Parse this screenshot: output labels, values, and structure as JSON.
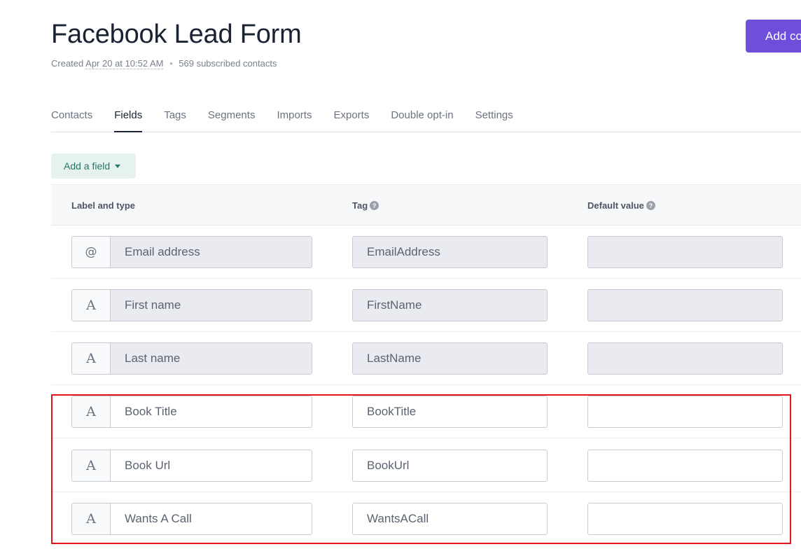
{
  "header": {
    "title": "Facebook Lead Form",
    "created_prefix": "Created",
    "created_date": "Apr 20 at 10:52 AM",
    "separator": "•",
    "subscribed": "569 subscribed contacts",
    "add_button_label": "Add contact"
  },
  "tabs": [
    {
      "label": "Contacts"
    },
    {
      "label": "Fields",
      "active": true
    },
    {
      "label": "Tags"
    },
    {
      "label": "Segments"
    },
    {
      "label": "Imports"
    },
    {
      "label": "Exports"
    },
    {
      "label": "Double opt-in"
    },
    {
      "label": "Settings"
    }
  ],
  "add_field": {
    "label": "Add a field"
  },
  "table": {
    "headers": {
      "label_type": "Label and type",
      "tag": "Tag",
      "default_value": "Default value",
      "help_glyph": "?"
    },
    "rows": [
      {
        "icon": "@",
        "icon_name": "email-type-icon",
        "label": "Email address",
        "tag": "EmailAddress",
        "default": "",
        "locked": true
      },
      {
        "icon": "A",
        "icon_name": "text-type-icon",
        "label": "First name",
        "tag": "FirstName",
        "default": "",
        "locked": true
      },
      {
        "icon": "A",
        "icon_name": "text-type-icon",
        "label": "Last name",
        "tag": "LastName",
        "default": "",
        "locked": true
      },
      {
        "icon": "A",
        "icon_name": "text-type-icon",
        "label": "Book Title",
        "tag": "BookTitle",
        "default": "",
        "locked": false
      },
      {
        "icon": "A",
        "icon_name": "text-type-icon",
        "label": "Book Url",
        "tag": "BookUrl",
        "default": "",
        "locked": false
      },
      {
        "icon": "A",
        "icon_name": "text-type-icon",
        "label": "Wants A Call",
        "tag": "WantsACall",
        "default": "",
        "locked": false
      }
    ]
  },
  "colors": {
    "accent": "#6d4fdc",
    "highlight": "#e3141a",
    "add_field_bg": "#e5f2ee",
    "add_field_text": "#25776a"
  }
}
